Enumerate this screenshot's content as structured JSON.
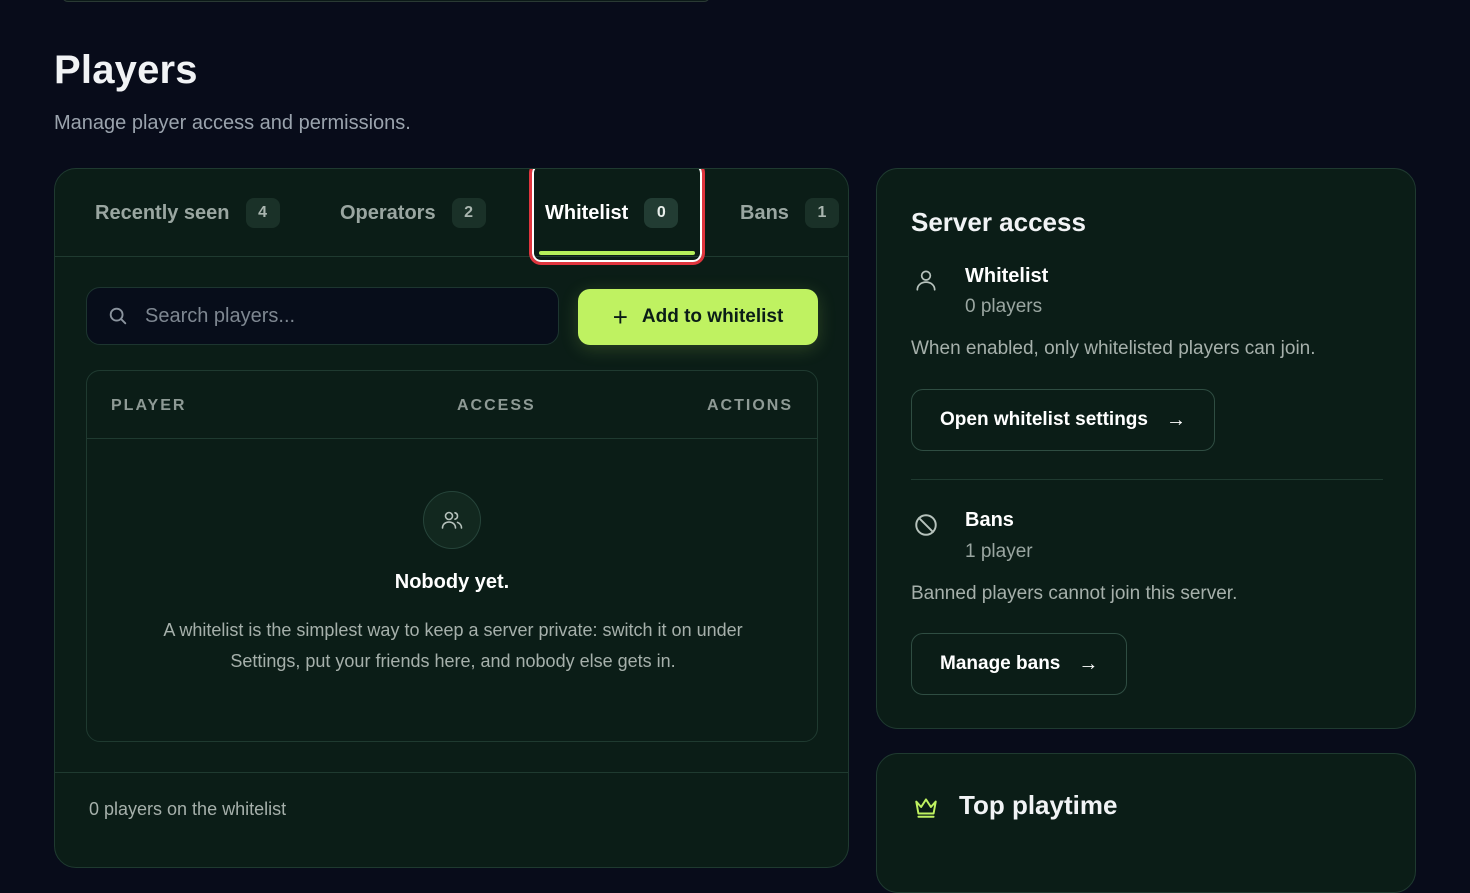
{
  "header": {
    "title": "Players",
    "subtitle": "Manage player access and permissions."
  },
  "tabs": [
    {
      "label": "Recently seen",
      "count": "4"
    },
    {
      "label": "Operators",
      "count": "2"
    },
    {
      "label": "Whitelist",
      "count": "0",
      "active": true
    },
    {
      "label": "Bans",
      "count": "1"
    }
  ],
  "search": {
    "placeholder": "Search players..."
  },
  "add_button": {
    "label": "Add to whitelist"
  },
  "table": {
    "columns": [
      "PLAYER",
      "ACCESS",
      "ACTIONS"
    ],
    "empty_title": "Nobody yet.",
    "empty_desc": "A whitelist is the simplest way to keep a server private: switch it on under Settings, put your friends here, and nobody else gets in."
  },
  "footer": {
    "text": "0 players on the whitelist"
  },
  "server_access": {
    "title": "Server access",
    "whitelist": {
      "name": "Whitelist",
      "count": "0 players",
      "desc": "When enabled, only whitelisted players can join.",
      "button": "Open whitelist settings"
    },
    "bans": {
      "name": "Bans",
      "count": "1 player",
      "desc": "Banned players cannot join this server.",
      "button": "Manage bans"
    }
  },
  "top_playtime": {
    "title": "Top playtime"
  },
  "colors": {
    "accent": "#bff261",
    "background": "#080c1a",
    "panel": "#0b1d17",
    "highlight": "#e0353e"
  },
  "icons": {
    "search": "search-icon",
    "plus": "plus-icon",
    "users": "users-icon",
    "user": "user-icon",
    "ban": "ban-icon",
    "arrow": "arrow-right-icon",
    "crown": "crown-icon"
  }
}
